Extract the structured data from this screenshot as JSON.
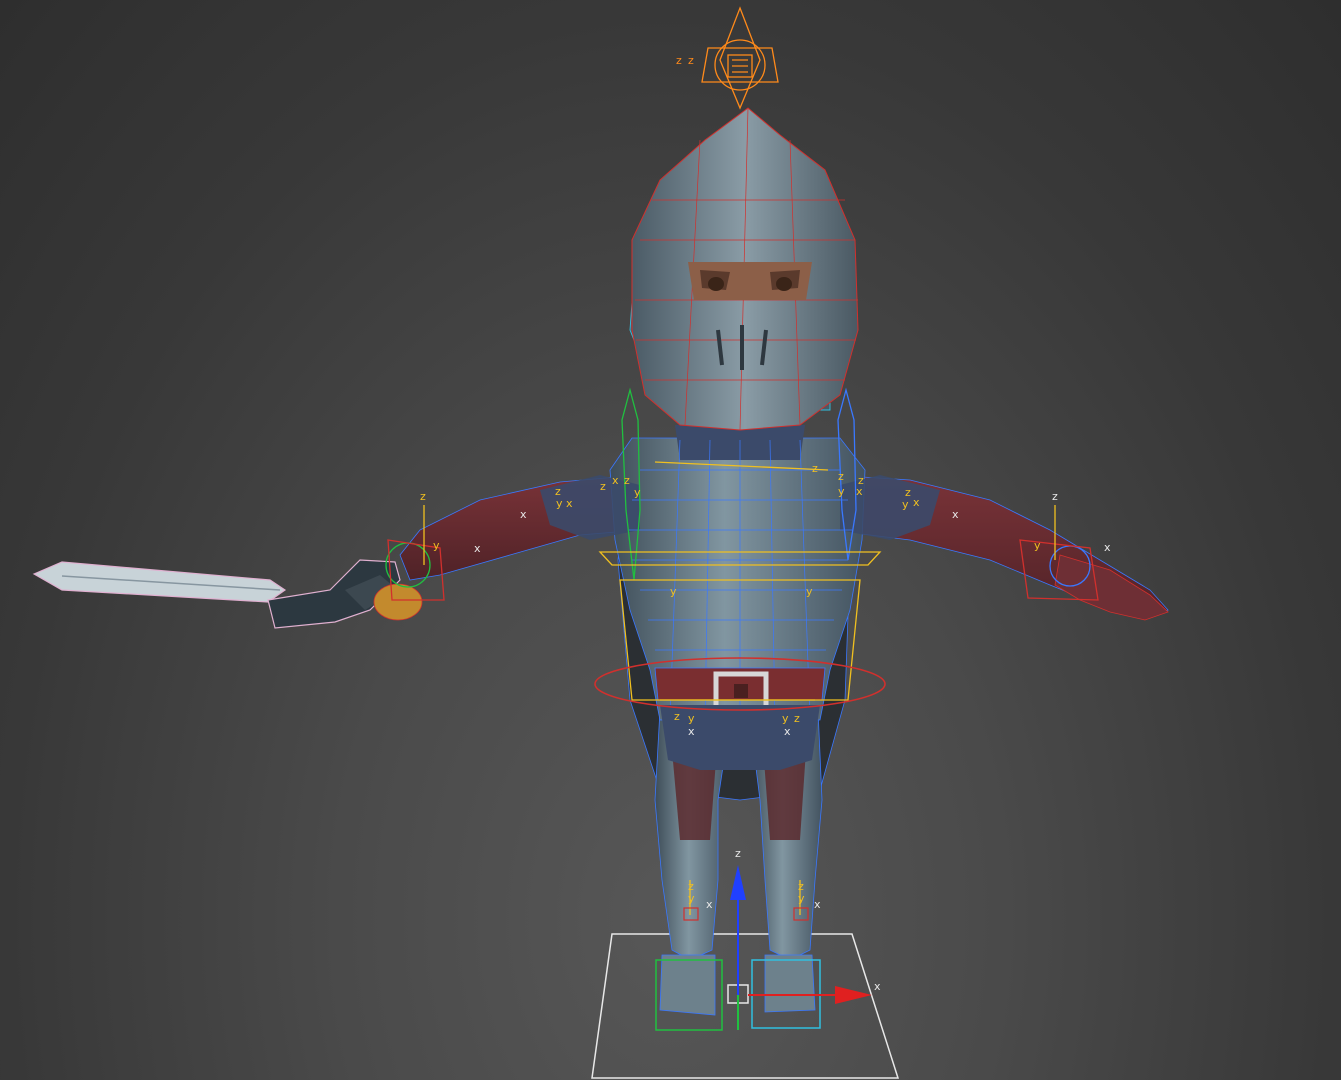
{
  "viewport": {
    "background": "#3d3d3d",
    "colors": {
      "armor": "#6f8590",
      "armor_dark": "#3f4e58",
      "cloth_red": "#6e2f35",
      "wire_blue": "#3a78ff",
      "wire_red": "#d1302d",
      "gizmo_orange": "#ff8a1a",
      "bone_yellow": "#f0c020",
      "biped_green": "#20c040",
      "biped_cyan": "#30c0e0",
      "axis_red": "#e02020",
      "axis_blue": "#2040ff",
      "grid_white": "#e8e8e8",
      "sword_pink": "#e0b0d0"
    }
  },
  "axis_labels": {
    "z": "z",
    "y": "y",
    "x": "x"
  }
}
